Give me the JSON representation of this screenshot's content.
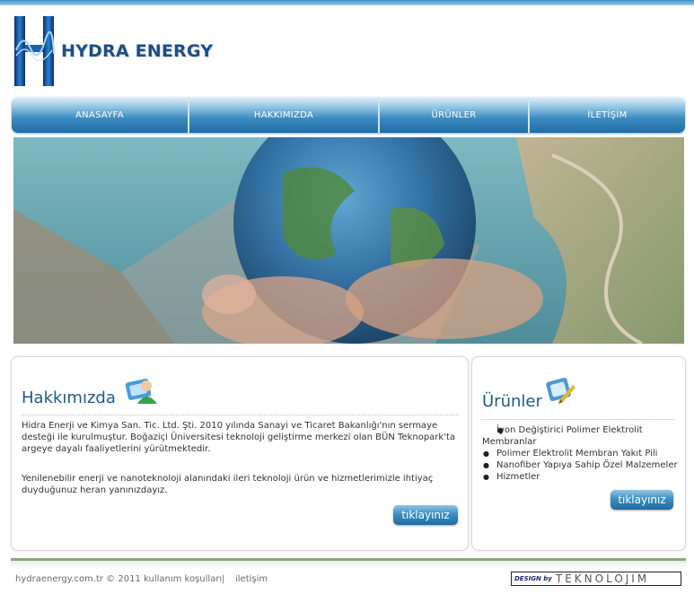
{
  "brand": {
    "name": "HYDRA ENERGY"
  },
  "nav": {
    "items": [
      {
        "label": "ANASAYFA"
      },
      {
        "label": "HAKKIMIZDA"
      },
      {
        "label": "ÜRÜNLER"
      },
      {
        "label": "İLETİŞİM"
      }
    ]
  },
  "about": {
    "title": "Hakkımızda",
    "paragraph1": "Hidra Enerji ve Kimya San. Tic. Ltd. Şti. 2010 yılında Sanayi ve Ticaret Bakanlığı'nın sermaye desteği ile kurulmuştur. Boğaziçi Üniversitesi teknoloji geliştirme merkezi olan BÜN Teknopark'ta argeye dayalı faaliyetlerini yürütmektedir.",
    "paragraph2": "Yenilenebilir enerji ve nanoteknoloji alanındaki ileri teknoloji ürün ve hizmetlerimizle ihtiyaç duyduğunuz heran yanınızdayız.",
    "button": "tıklayınız"
  },
  "products": {
    "title": "Ürünler",
    "items": [
      "İyon Değiştirici Polimer Elektrolit Membranlar",
      "Polimer Elektrolit Membran Yakıt Pili",
      "Nanofiber Yapıya Sahip Özel Malzemeler",
      "Hizmetler"
    ],
    "button": "tıklayınız"
  },
  "footer": {
    "site": "hydraenergy.com.tr © 2011 kullanım koşulları",
    "separator": "|",
    "contact": "iletişim",
    "design_small": "DESIGN by",
    "design_big": "TEKNOLOJIM"
  },
  "colors": {
    "accent": "#1c5a8a",
    "nav_top": "#8ec2e2",
    "nav_bottom": "#1f6ea7",
    "footer_line": "#8ba77f"
  },
  "icons": {
    "logo": "h-logo-icon",
    "about": "person-card-icon",
    "products": "notebook-pen-icon"
  }
}
